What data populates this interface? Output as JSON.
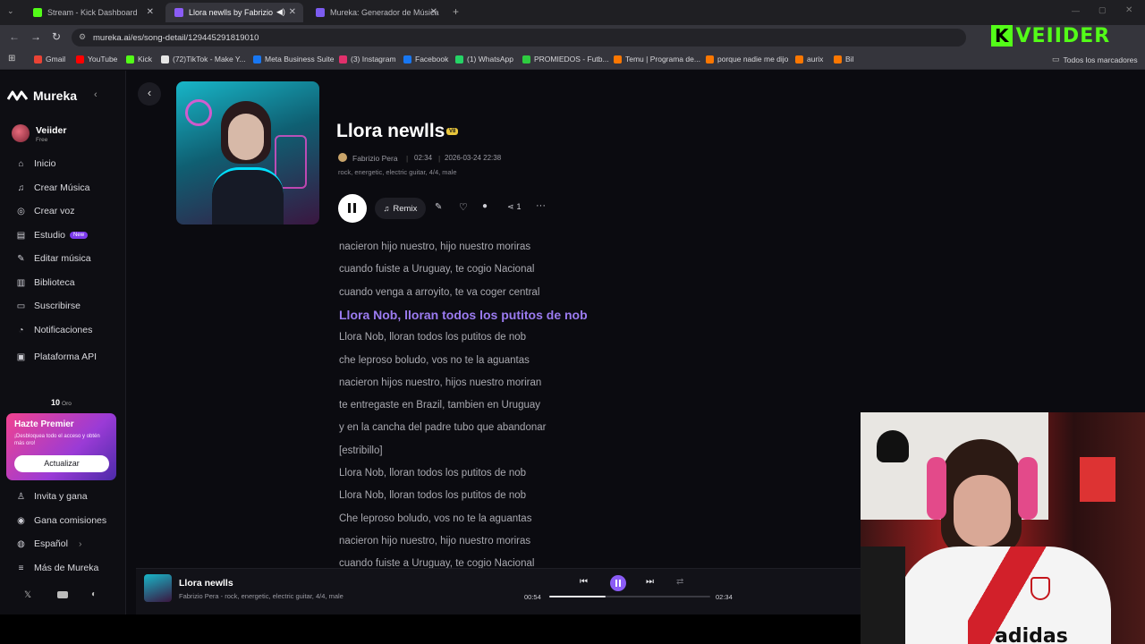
{
  "browser": {
    "tabs": [
      {
        "title": "Stream - Kick Dashboard",
        "color": "#53fc18"
      },
      {
        "title": "Llora newlls by Fabrizio Pera",
        "color": "#8b5cf6"
      },
      {
        "title": "Mureka: Generador de Música",
        "color": "#7c5cf0"
      }
    ],
    "url": "mureka.ai/es/song-detail/129445291819010",
    "bookmarks": [
      {
        "label": "Gmail",
        "color": "#ea4335"
      },
      {
        "label": "YouTube",
        "color": "#ff0000"
      },
      {
        "label": "Kick",
        "color": "#53fc18"
      },
      {
        "label": "(72)TikTok - Make Y...",
        "color": "#e5e5e5"
      },
      {
        "label": "Meta Business Suite",
        "color": "#1877f2"
      },
      {
        "label": "(3) Instagram",
        "color": "#e1306c"
      },
      {
        "label": "Facebook",
        "color": "#1877f2"
      },
      {
        "label": "(1) WhatsApp",
        "color": "#25d366"
      },
      {
        "label": "PROMIEDOS - Futb...",
        "color": "#2ecc40"
      },
      {
        "label": "Temu | Programa de...",
        "color": "#fb7701"
      },
      {
        "label": "porque nadie me dijo",
        "color": "#fb7701"
      },
      {
        "label": "aurix",
        "color": "#fb7701"
      },
      {
        "label": "Bil",
        "color": "#fb7701"
      }
    ],
    "all_bookmarks": "Todos los marcadores"
  },
  "overlay_logo": "VEIIDER",
  "sidebar": {
    "brand": "Mureka",
    "user": {
      "name": "Veiider",
      "plan": "Free"
    },
    "nav": [
      {
        "label": "Inicio",
        "icon": "home-icon",
        "glyph": "⌂"
      },
      {
        "label": "Crear Música",
        "icon": "music-icon",
        "glyph": "♫"
      },
      {
        "label": "Crear voz",
        "icon": "voice-icon",
        "glyph": "◎"
      },
      {
        "label": "Estudio",
        "icon": "studio-icon",
        "glyph": "▤",
        "badge": "New"
      },
      {
        "label": "Editar música",
        "icon": "edit-icon",
        "glyph": "✎"
      },
      {
        "label": "Biblioteca",
        "icon": "library-icon",
        "glyph": "▥"
      },
      {
        "label": "Suscribirse",
        "icon": "subscribe-icon",
        "glyph": "▭"
      },
      {
        "label": "Notificaciones",
        "icon": "bell-icon",
        "glyph": "◔"
      },
      {
        "label": "Plataforma API",
        "icon": "api-icon",
        "glyph": "▣"
      }
    ],
    "credits": {
      "value": "10",
      "unit": "Oro"
    },
    "promo": {
      "title": "Hazte Premier",
      "text": "¡Desbloquea todo el acceso y obtén más oro!",
      "button": "Actualizar"
    },
    "footer": [
      {
        "label": "Invita y gana",
        "icon": "invite-icon",
        "glyph": "♙"
      },
      {
        "label": "Gana comisiones",
        "icon": "commission-icon",
        "glyph": "◉"
      },
      {
        "label": "Español",
        "icon": "language-icon",
        "glyph": "◍"
      },
      {
        "label": "Más de Mureka",
        "icon": "menu-icon",
        "glyph": "≡"
      }
    ]
  },
  "song": {
    "title": "Llora newlls",
    "version": "V8",
    "author": "Fabrizio Pera",
    "duration": "02:34",
    "date": "2026-03-24 22:38",
    "tags": "rock, energetic, electric guitar, 4/4, male",
    "remix_label": "Remix",
    "share_count": "1"
  },
  "lyrics": [
    "nacieron hijo nuestro, hijo nuestro moriras",
    "cuando fuiste a Uruguay, te cogio Nacional",
    "cuando venga a arroyito, te va coger central",
    "Llora Nob, lloran todos los putitos de nob",
    "Llora Nob, lloran todos los putitos de nob",
    "che leproso boludo, vos no te la aguantas",
    "nacieron hijos nuestro, hijos nuestro moriran",
    "te entregaste en Brazil, tambien en Uruguay",
    "y en la cancha del padre tubo que abandonar",
    "[estribillo]",
    "Llora Nob, lloran todos los putitos de nob",
    "Llora Nob, lloran todos los putitos de nob",
    "Che leproso boludo, vos no te la aguantas",
    "nacieron hijo nuestro, hijo nuestro moriras",
    "cuando fuiste a Uruguay, te cogio Nacional",
    "Llora Nob, lloran todos los putitos de nob"
  ],
  "player": {
    "title": "Llora newlls",
    "subtitle": "Fabrizio Pera - rock, energetic, electric guitar, 4/4, male",
    "elapsed": "00:54",
    "total": "02:34",
    "progress": 0.35
  },
  "webcam": {
    "jersey_text": "adidas"
  },
  "colors": {
    "accent": "#8b5cf6",
    "highlight": "#9b7bf0"
  }
}
